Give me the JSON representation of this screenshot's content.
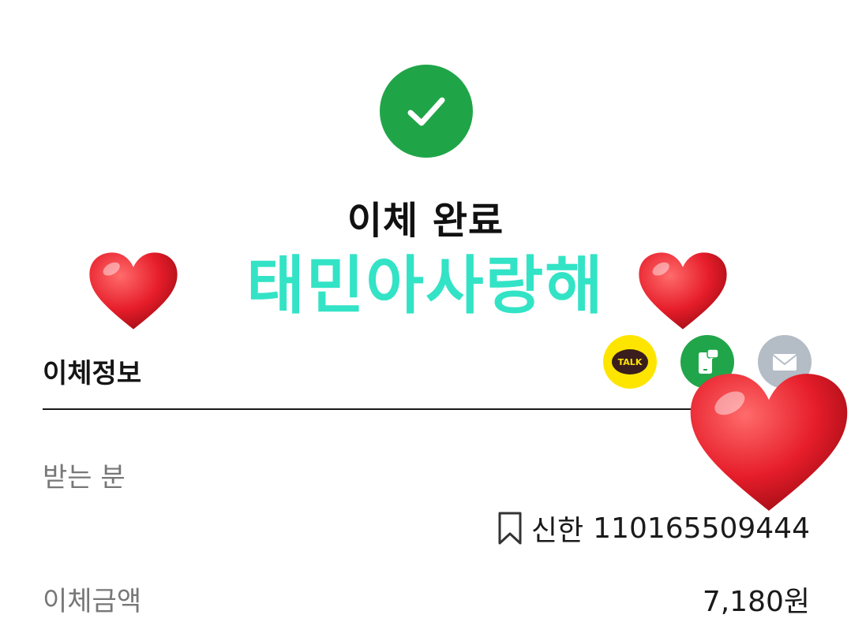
{
  "status": {
    "icon": "check-icon",
    "color": "#1fa548",
    "title": "이체 완료"
  },
  "sticker": {
    "text": "태민아사랑해",
    "text_color": "#33e3c6",
    "decorations": [
      "heart-icon",
      "heart-icon",
      "heart-icon"
    ]
  },
  "transfer_info": {
    "section_title": "이체정보",
    "share_buttons": [
      {
        "name": "kakaotalk-share",
        "icon": "kakaotalk-icon",
        "label": "TALK",
        "color": "#fee500"
      },
      {
        "name": "sms-share",
        "icon": "message-icon",
        "color": "#21a54a"
      },
      {
        "name": "email-share",
        "icon": "mail-icon",
        "color": "#b4bcc6"
      }
    ],
    "recipient": {
      "label": "받는 분",
      "bank": "신한",
      "account_number": "110165509444"
    },
    "amount": {
      "label": "이체금액",
      "value": "7,180원"
    }
  }
}
